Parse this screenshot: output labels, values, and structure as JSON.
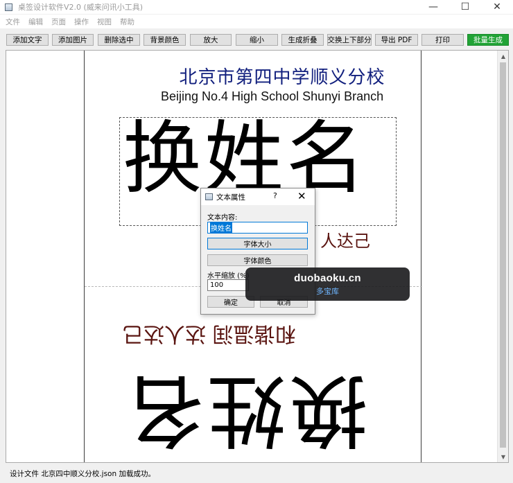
{
  "window": {
    "title": "桌签设计软件V2.0 (威来问讯小工具)",
    "minimize_glyph": "—",
    "maximize_glyph": "☐",
    "close_glyph": "✕"
  },
  "menu": [
    "文件",
    "编辑",
    "页面",
    "操作",
    "视图",
    "帮助"
  ],
  "toolbar": {
    "add_text": "添加文字",
    "add_image": "添加图片",
    "delete_selected": "删除选中",
    "bg_color": "背景颜色",
    "zoom_in": "放大",
    "zoom_out": "缩小",
    "generate_fold": "生成折叠",
    "swap_halves": "交换上下部分",
    "export_pdf": "导出 PDF",
    "print": "打印",
    "batch_generate": "批量生成"
  },
  "canvas": {
    "school_cn": "北京市第四中学顺义分校",
    "school_en": "Beijing No.4 High School Shunyi Branch",
    "name_text": "换姓名",
    "motto_right": "人达己",
    "motto_flipped": "和谐温润 达人达己",
    "name_flipped": "换姓名"
  },
  "dialog": {
    "title": "文本属性",
    "help": "?",
    "close": "✕",
    "content_label": "文本内容:",
    "content_value": "换姓名",
    "font_size_button": "字体大小",
    "font_color_button": "字体颜色",
    "scale_label": "水平缩放 (%)",
    "scale_value": "100",
    "ok_button": "确定",
    "cancel_button": "取消"
  },
  "watermark": {
    "domain": "duobaoku.cn",
    "name": "多宝库"
  },
  "status": {
    "message": "设计文件 北京四中顺义分校.json 加载成功。"
  },
  "scrollbar": {
    "up": "▲",
    "down": "▼"
  }
}
